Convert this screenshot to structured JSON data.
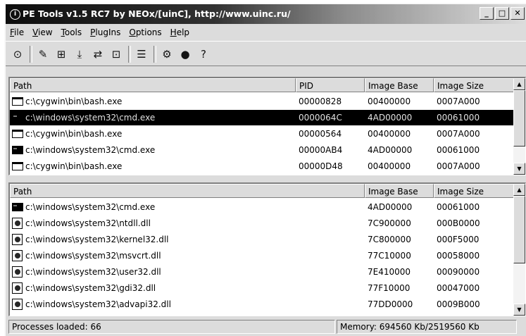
{
  "window": {
    "title": "PE Tools v1.5 RC7 by NEOx/[uinC], http://www.uinc.ru/",
    "minimize": "_",
    "maximize": "□",
    "close": "✕"
  },
  "menu": [
    "File",
    "View",
    "Tools",
    "PlugIns",
    "Options",
    "Help"
  ],
  "toolbar": {
    "icons": [
      "refresh-icon",
      "edit-icon",
      "break-icon",
      "dump-full-icon",
      "dump-partial-icon",
      "dump-region-icon",
      "list-icon",
      "options-icon",
      "globe-icon",
      "help-icon"
    ],
    "glyphs": [
      "⊙",
      "✎",
      "⊞",
      "⤓",
      "⇄",
      "⊡",
      "☰",
      "⚙",
      "●",
      "?"
    ]
  },
  "processes": {
    "columns": [
      "Path",
      "PID",
      "Image Base",
      "Image Size"
    ],
    "rows": [
      {
        "icon": "bash",
        "path": "c:\\cygwin\\bin\\bash.exe",
        "pid": "00000828",
        "base": "00400000",
        "size": "0007A000"
      },
      {
        "icon": "cmd",
        "path": "c:\\windows\\system32\\cmd.exe",
        "pid": "0000064C",
        "base": "4AD00000",
        "size": "00061000",
        "selected": true
      },
      {
        "icon": "bash",
        "path": "c:\\cygwin\\bin\\bash.exe",
        "pid": "00000564",
        "base": "00400000",
        "size": "0007A000"
      },
      {
        "icon": "cmd",
        "path": "c:\\windows\\system32\\cmd.exe",
        "pid": "00000AB4",
        "base": "4AD00000",
        "size": "00061000"
      },
      {
        "icon": "bash",
        "path": "c:\\cygwin\\bin\\bash.exe",
        "pid": "00000D48",
        "base": "00400000",
        "size": "0007A000"
      }
    ]
  },
  "modules": {
    "columns": [
      "Path",
      "Image Base",
      "Image Size"
    ],
    "rows": [
      {
        "icon": "cmd",
        "path": "c:\\windows\\system32\\cmd.exe",
        "base": "4AD00000",
        "size": "00061000"
      },
      {
        "icon": "dll",
        "path": "c:\\windows\\system32\\ntdll.dll",
        "base": "7C900000",
        "size": "000B0000"
      },
      {
        "icon": "dll",
        "path": "c:\\windows\\system32\\kernel32.dll",
        "base": "7C800000",
        "size": "000F5000"
      },
      {
        "icon": "dll",
        "path": "c:\\windows\\system32\\msvcrt.dll",
        "base": "77C10000",
        "size": "00058000"
      },
      {
        "icon": "dll",
        "path": "c:\\windows\\system32\\user32.dll",
        "base": "7E410000",
        "size": "00090000"
      },
      {
        "icon": "dll",
        "path": "c:\\windows\\system32\\gdi32.dll",
        "base": "77F10000",
        "size": "00047000"
      },
      {
        "icon": "dll",
        "path": "c:\\windows\\system32\\advapi32.dll",
        "base": "77DD0000",
        "size": "0009B000"
      }
    ]
  },
  "status": {
    "processes": "Processes loaded: 66",
    "memory": "Memory: 694560 Kb/2519560 Kb"
  },
  "scroll": {
    "up": "▲",
    "down": "▼"
  }
}
